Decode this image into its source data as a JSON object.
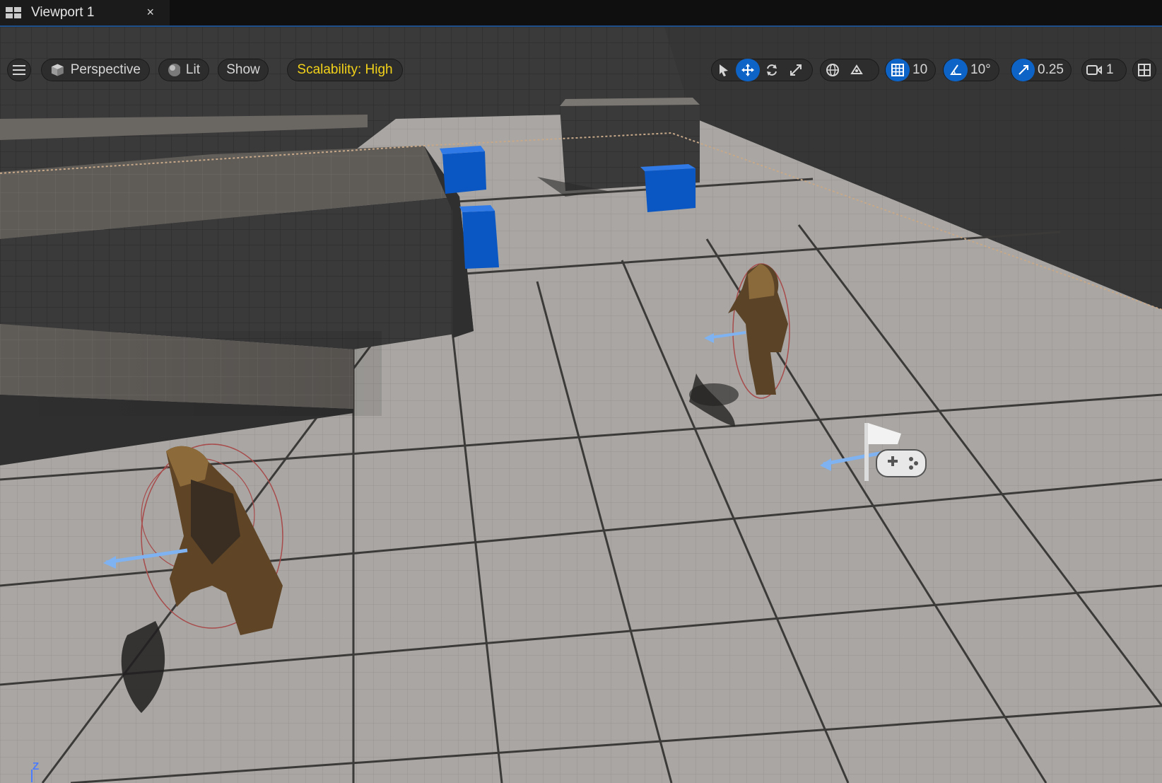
{
  "tab": {
    "title": "Viewport 1",
    "close": "×",
    "icon": "layout-grid-icon"
  },
  "toolbar": {
    "menu_icon": "hamburger-icon",
    "perspective_label": "Perspective",
    "perspective_icon": "cube-icon",
    "lit_label": "Lit",
    "lit_icon": "sphere-icon",
    "show_label": "Show",
    "scalability_label": "Scalability: High",
    "transform_tools": [
      "select-icon",
      "translate-icon",
      "rotate-icon",
      "scale-icon"
    ],
    "grid_snap_value": "10",
    "angle_snap_value": "10°",
    "scale_snap_value": "0.25",
    "camera_speed_value": "1",
    "layout_icon": "viewport-layout-icon"
  },
  "colors": {
    "accent": "#0e63c6",
    "scalability": "#f3d21a",
    "floor": "#a9a6a3"
  },
  "axis_label": "Z"
}
